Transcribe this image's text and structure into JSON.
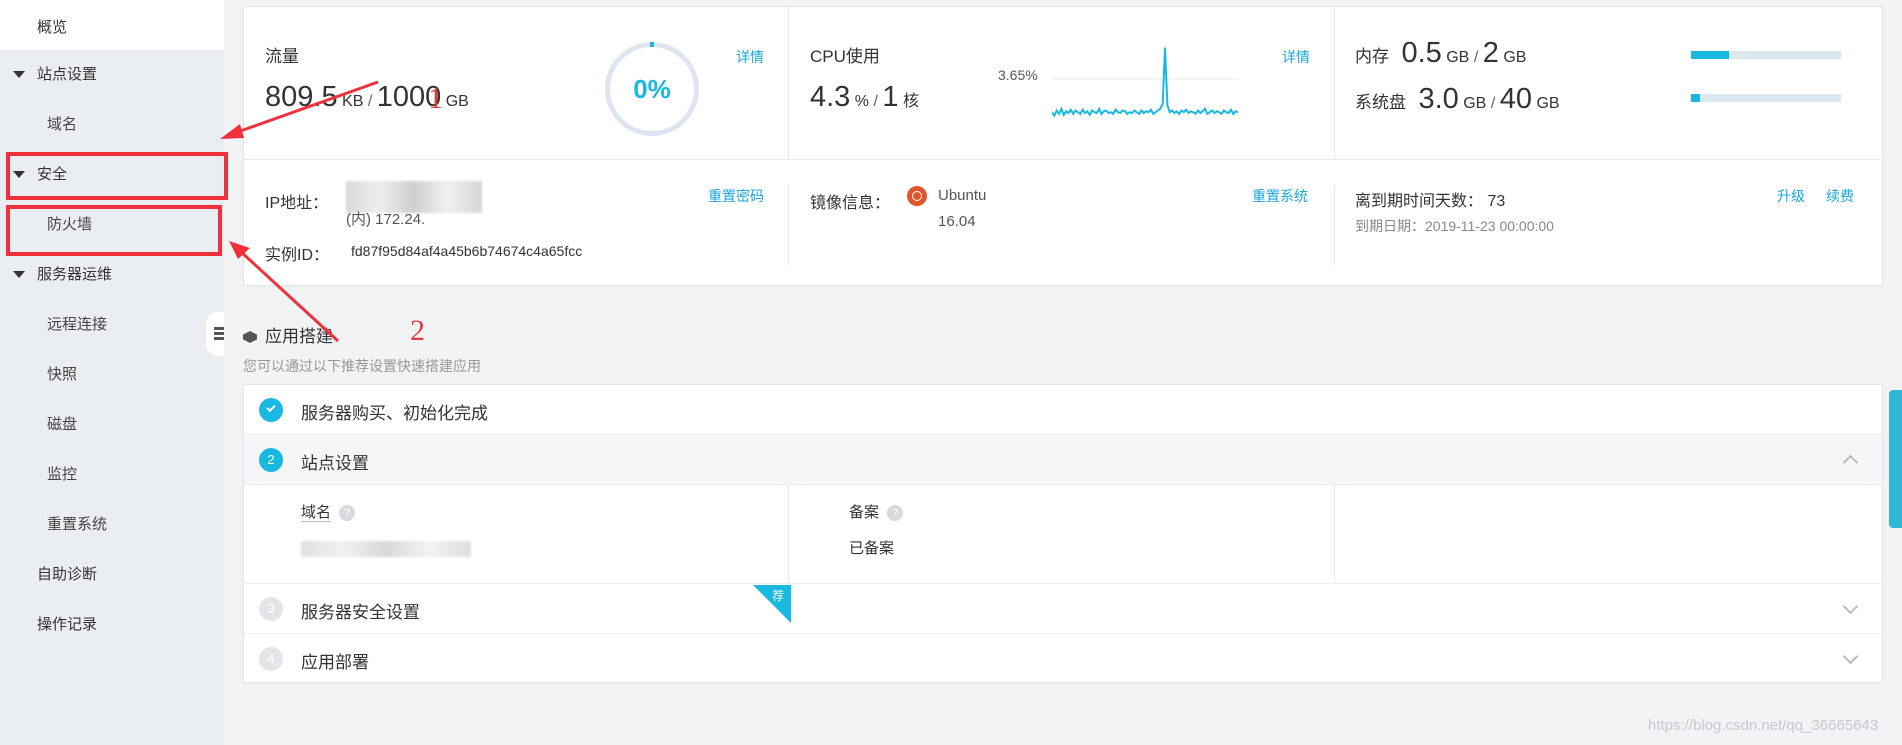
{
  "sidebar": {
    "overview": "概览",
    "site_settings": "站点设置",
    "domain": "域名",
    "security": "安全",
    "firewall": "防火墙",
    "ops": "服务器运维",
    "remote": "远程连接",
    "snapshot": "快照",
    "disk": "磁盘",
    "monitor": "监控",
    "reset_system": "重置系统",
    "self_diagnosis": "自助诊断",
    "op_log": "操作记录"
  },
  "traffic": {
    "label": "流量",
    "used": "809.5",
    "used_unit": "KB",
    "sep": "/",
    "total": "1000",
    "total_unit": "GB",
    "percent": "0%",
    "detail": "详情"
  },
  "cpu": {
    "label": "CPU使用",
    "usage": "4.3",
    "usage_unit": "%",
    "sep": "/",
    "cores": "1",
    "cores_unit": "核",
    "peak": "3.65%",
    "detail": "详情",
    "sparkline": [
      0.4,
      0.2,
      0.5,
      0.3,
      0.6,
      0.25,
      0.45,
      0.35,
      0.55,
      0.3,
      0.5,
      0.4,
      0.3,
      0.55,
      0.35,
      0.45,
      0.25,
      0.5,
      0.4,
      0.35,
      0.6,
      0.3,
      0.45,
      0.5,
      0.35,
      0.4,
      0.3,
      0.55,
      0.4,
      0.35,
      0.5,
      0.45,
      0.3,
      0.4,
      0.35,
      0.5,
      0.4,
      0.3,
      0.5,
      0.35,
      0.45,
      0.4,
      0.55,
      0.3,
      0.4,
      0.5,
      0.6,
      0.9,
      4.2,
      0.8,
      0.4,
      0.5,
      0.35,
      0.45,
      0.3,
      0.5,
      0.4,
      0.55,
      0.35,
      0.45,
      0.4,
      0.3,
      0.5,
      0.35,
      0.45,
      0.6,
      0.3,
      0.4,
      0.5,
      0.35,
      0.45,
      0.4,
      0.3,
      0.5,
      0.4,
      0.35,
      0.55,
      0.3,
      0.45,
      0.4
    ]
  },
  "memory": {
    "label": "内存",
    "used": "0.5",
    "used_unit": "GB",
    "sep": "/",
    "total": "2",
    "total_unit": "GB",
    "fill": 0.25
  },
  "disk": {
    "label": "系统盘",
    "used": "3.0",
    "used_unit": "GB",
    "sep": "/",
    "total": "40",
    "total_unit": "GB",
    "fill": 0.06
  },
  "ip": {
    "label": "IP地址：",
    "inner": "(内) 172.24.",
    "reset_pwd": "重置密码",
    "instance_label": "实例ID：",
    "instance_id": "fd87f95d84af4a45b6b74674c4a65fcc"
  },
  "image": {
    "label": "镜像信息：",
    "os": "Ubuntu",
    "version": "16.04",
    "reset_system": "重置系统"
  },
  "expiry": {
    "label": "离到期时间天数：",
    "days": "73",
    "upgrade": "升级",
    "renew": "续费",
    "date_label": "到期日期：",
    "date": "2019-11-23 00:00:00"
  },
  "app_build": {
    "title": "应用搭建",
    "subtitle": "您可以通过以下推荐设置快速搭建应用",
    "steps": [
      {
        "num": "1",
        "label": "服务器购买、初始化完成"
      },
      {
        "num": "2",
        "label": "站点设置"
      },
      {
        "num": "3",
        "label": "服务器安全设置"
      },
      {
        "num": "4",
        "label": "应用部署"
      }
    ],
    "domain_label": "域名",
    "record_label": "备案",
    "record_status": "已备案",
    "corner_tag": "荐",
    "help": "?"
  },
  "annotations": {
    "one": "1",
    "two": "2"
  },
  "watermark": "https://blog.csdn.net/qq_36665643",
  "colors": {
    "accent": "#19b8e0",
    "annotation": "#f0303a"
  }
}
